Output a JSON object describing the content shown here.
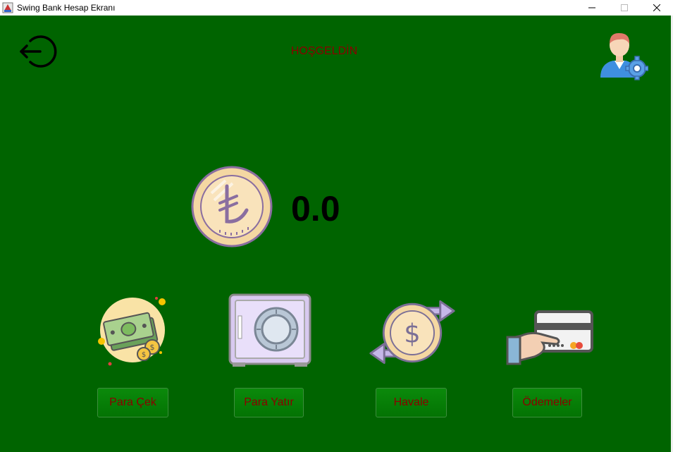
{
  "window": {
    "title": "Swing Bank Hesap Ekranı"
  },
  "header": {
    "welcome": "HOŞGELDİN"
  },
  "balance": {
    "amount": "0.0",
    "currency_icon": "lira-coin-icon"
  },
  "actions": [
    {
      "label": "Para Çek",
      "icon": "cash-withdraw-icon"
    },
    {
      "label": "Para Yatır",
      "icon": "safe-deposit-icon"
    },
    {
      "label": "Havale",
      "icon": "transfer-icon"
    },
    {
      "label": "Ödemeler",
      "icon": "card-payment-icon"
    }
  ],
  "colors": {
    "background": "#006400",
    "accent_text": "#8b0000",
    "button": "#0b8a0b"
  }
}
